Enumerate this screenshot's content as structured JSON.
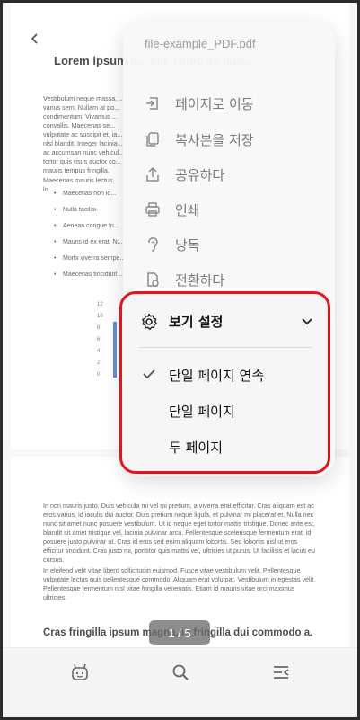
{
  "document": {
    "heading": "Lorem ipsum d... elit. Nunc ac fauc...",
    "p1": "Vestibulum neque massa, ... varius sem. Nullam at po... condimentum. Vivamus ... convallis. Maecenas se... vulputate ac suscipit et, ia... nisl blandit. Integer lacinia ... ac accumsan nunc vehicul... tortor quis risus auctor co... mauris tempus fringilla.",
    "p2": "Maecenas mauris lectus, lo...",
    "list": [
      "Maecenas non lo...",
      "Nulla facilisi.",
      "Aenean congue fri...",
      "Mauris id ex erat. N... sagittis.",
      "Morbi viverra sempe...",
      "Maecenas tincidunt ..."
    ],
    "chart_ticks": [
      "12",
      "10",
      "8",
      "6",
      "4",
      "2",
      "0"
    ],
    "p3": "In non mauris justo. Duis vehicula mi vel mi pretium, a viverra erat efficitur. Cras aliquam est ac eros varius, id iaculis dui auctor. Duis pretium neque ligula, et pulvinar mi placerat et. Nulla nec nunc sit amet nunc posuere vestibulum. Ut id neque eget tortor mattis tristique. Donec ante est, blandit sit amet tristique vel, lacinia pulvinar arcu. Pellentesque scelerisque fermentum erat, id posuere justo pulvinar ut. Cras id eros sed enim aliquam lobortis. Sed lobortis nisl ut eros efficitur tincidunt. Cras justo mi, porttitor quis mattis vel, ultricies ut purus. Ut facilisis et lacus eu cursus.",
    "p4": "In eleifend velit vitae libero sollicitudin euismod. Fusce vitae vestibulum velit. Pellentesque vulputate lectus quis pellentesque commodo. Aliquam erat volutpat. Vestibulum in egestas velit. Pellentesque fermentum nisl vitae fringilla venenatis. Etiam id mauris vitae orci maximus ultricies.",
    "heading2": "Cras fringilla ipsum magna, in fringilla dui commodo a."
  },
  "page_indicator": "1 / 5",
  "popup": {
    "file_name": "file-example_PDF.pdf",
    "items": [
      {
        "label": "페이지로 이동",
        "icon": "goto-page-icon"
      },
      {
        "label": "복사본을 저장",
        "icon": "save-copy-icon"
      },
      {
        "label": "공유하다",
        "icon": "share-icon"
      },
      {
        "label": "인쇄",
        "icon": "print-icon"
      },
      {
        "label": "낭독",
        "icon": "read-aloud-icon"
      },
      {
        "label": "전환하다",
        "icon": "convert-icon"
      }
    ]
  },
  "view_settings": {
    "title": "보기 설정",
    "options": [
      {
        "label": "단일 페이지 연속",
        "selected": true
      },
      {
        "label": "단일 페이지",
        "selected": false
      },
      {
        "label": "두 페이지",
        "selected": false
      }
    ]
  },
  "colors": {
    "highlight_border": "#e5141b",
    "chart_bar": "#3b64c4"
  }
}
